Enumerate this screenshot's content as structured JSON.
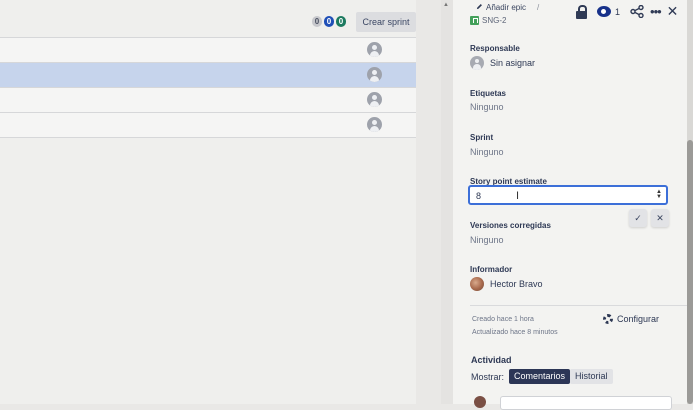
{
  "sprint": {
    "counts": [
      "0",
      "0",
      "0"
    ],
    "create_sprint_label": "Crear sprint",
    "rows": [
      {
        "selected": false
      },
      {
        "selected": true
      },
      {
        "selected": false
      },
      {
        "selected": false
      }
    ]
  },
  "issue": {
    "add_epic_label": "Añadir epic",
    "breadcrumb_separator": "/",
    "key": "SNG-2",
    "watchers_count": "1"
  },
  "fields": {
    "assignee_label": "Responsable",
    "assignee_value": "Sin asignar",
    "labels_label": "Etiquetas",
    "labels_value": "Ninguno",
    "sprint_label": "Sprint",
    "sprint_value": "Ninguno",
    "story_points_label": "Story point estimate",
    "story_points_value": "8",
    "fix_versions_label": "Versiones corregidas",
    "fix_versions_value": "Ninguno",
    "reporter_label": "Informador",
    "reporter_value": "Hector Bravo"
  },
  "meta": {
    "created": "Creado hace 1 hora",
    "updated": "Actualizado hace 8 minutos",
    "configure_label": "Configurar"
  },
  "activity": {
    "title": "Actividad",
    "show_label": "Mostrar:",
    "tabs": [
      {
        "label": "Comentarios",
        "active": true
      },
      {
        "label": "Historial",
        "active": false
      }
    ]
  },
  "colors": {
    "accent": "#3c6fd8",
    "selected_row": "#c6d4ec",
    "active_tab": "#2c3656",
    "story_green": "#43a05a"
  },
  "icons": [
    "pencil-icon",
    "story-icon",
    "lock-icon",
    "eye-icon",
    "share-icon",
    "more-icon",
    "close-icon",
    "avatar-icon",
    "check-icon",
    "cancel-icon",
    "gear-icon"
  ]
}
